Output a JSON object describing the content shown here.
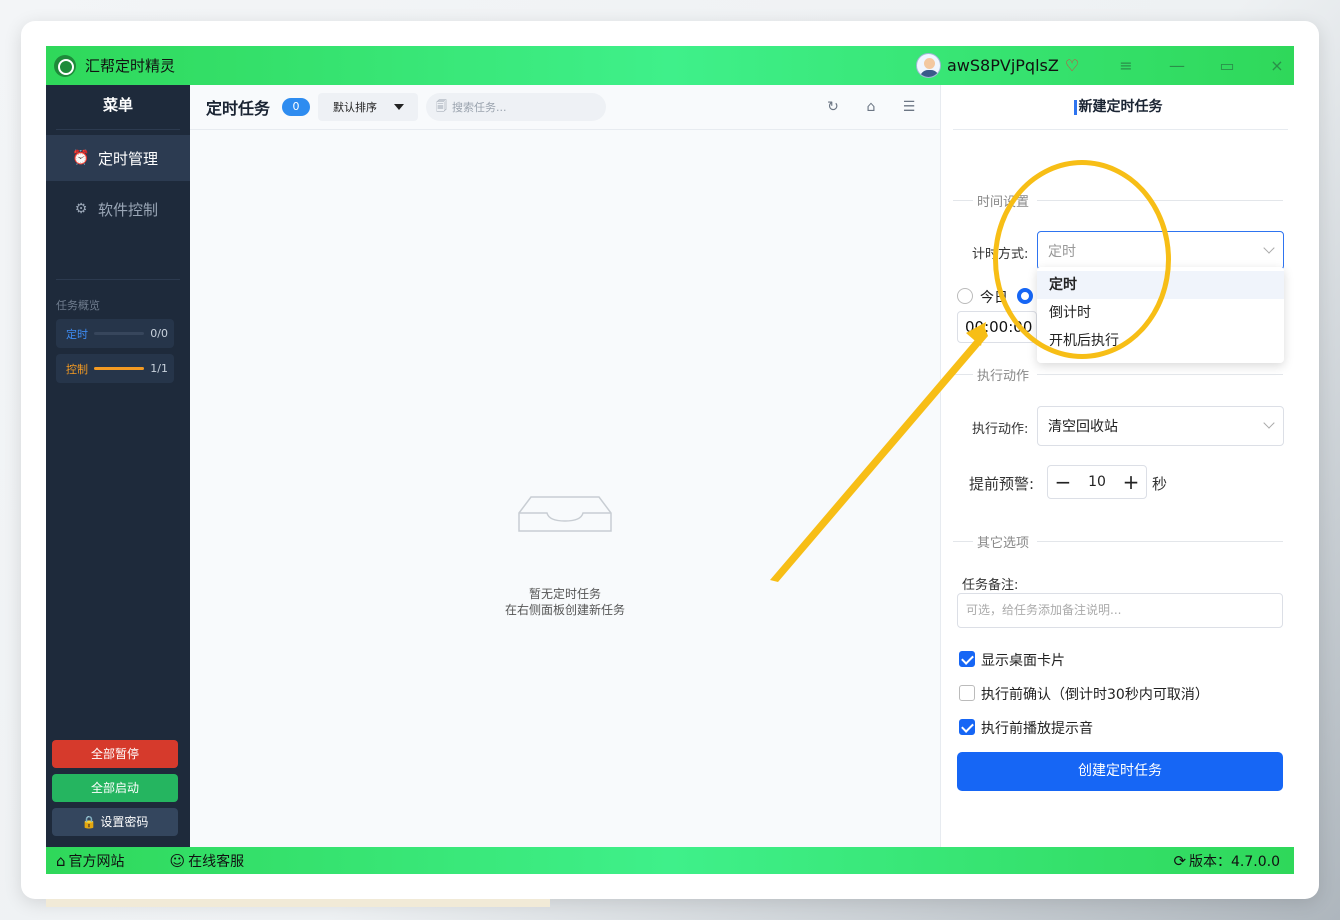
{
  "app": {
    "title": "汇帮定时精灵",
    "username": "awS8PVjPqlsZ"
  },
  "sidebar": {
    "menu_title": "菜单",
    "items": [
      {
        "label": "定时管理",
        "icon": "alarm-clock-icon",
        "active": true
      },
      {
        "label": "软件控制",
        "icon": "gear-icon",
        "active": false
      }
    ],
    "overview_title": "任务概览",
    "overview": [
      {
        "label": "定时",
        "count": "0/0",
        "progress": 0,
        "color": "#3d8bf2"
      },
      {
        "label": "控制",
        "count": "1/1",
        "progress": 1,
        "color": "#f39a22"
      }
    ],
    "buttons": {
      "pause_all": "全部暂停",
      "start_all": "全部启动",
      "set_password": "设置密码"
    }
  },
  "main": {
    "title": "定时任务",
    "task_count": "0",
    "sort_label": "默认排序",
    "search_placeholder": "搜索任务...",
    "empty_line1": "暂无定时任务",
    "empty_line2": "在右侧面板创建新任务"
  },
  "panel": {
    "title": "新建定时任务",
    "time_section": "时间设置",
    "timing_mode_label": "计时方式:",
    "timing_mode_value": "定时",
    "timing_options": [
      "定时",
      "倒计时",
      "开机后执行"
    ],
    "radio_today": "今日",
    "time_value": "00:00:00",
    "action_section": "执行动作",
    "action_label": "执行动作:",
    "action_value": "清空回收站",
    "warn_label": "提前预警:",
    "warn_value": "10",
    "warn_unit": "秒",
    "other_section": "其它选项",
    "notes_label": "任务备注:",
    "notes_placeholder": "可选，给任务添加备注说明...",
    "checks": [
      {
        "label": "显示桌面卡片",
        "checked": true
      },
      {
        "label": "执行前确认（倒计时30秒内可取消）",
        "checked": false
      },
      {
        "label": "执行前播放提示音",
        "checked": true
      }
    ],
    "create_button": "创建定时任务"
  },
  "statusbar": {
    "website": "官方网站",
    "support": "在线客服",
    "version": "版本：4.7.0.0"
  },
  "colors": {
    "accent_green": "#3ff08a",
    "primary_blue": "#1666f5",
    "sidebar_bg": "#1e2a3b",
    "highlight_yellow": "#f7be16",
    "danger_red": "#d63a2c",
    "success_green": "#25b560"
  }
}
